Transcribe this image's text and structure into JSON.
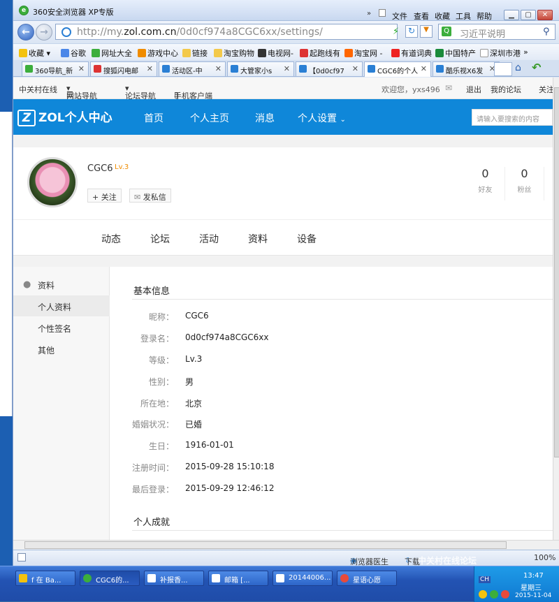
{
  "browser": {
    "title": "360安全浏览器 XP专版",
    "menu": [
      "文件",
      "查看",
      "收藏",
      "工具",
      "帮助"
    ],
    "address_prefix": "http://my.",
    "address_domain": "zol.com.cn",
    "address_suffix": "/0d0cf974a8CGC6xx/settings/",
    "search_text": "习近平说明",
    "favorites": [
      "收藏",
      "谷歌",
      "网址大全",
      "游戏中心",
      "链接",
      "淘宝购物",
      "电视网-",
      "起跑线有",
      "淘宝网 -",
      "有道词典",
      "中国特产",
      "深圳市港"
    ],
    "tabs": [
      {
        "label": "360导航_新",
        "color": "#3cae3c"
      },
      {
        "label": "搜狐闪电邮",
        "color": "#d33"
      },
      {
        "label": "活动区-中",
        "color": "#2a7fd4"
      },
      {
        "label": "大管家小s",
        "color": "#2a7fd4"
      },
      {
        "label": "【0d0cf97",
        "color": "#2a7fd4"
      },
      {
        "label": "CGC6的个人",
        "color": "#2a7fd4"
      },
      {
        "label": "酷乐视X6发",
        "color": "#2a7fd4"
      }
    ]
  },
  "site": {
    "topnav": {
      "home": "中关村在线",
      "site_nav": "网站导航",
      "forum_nav": "论坛导航",
      "mobile": "手机客户端",
      "welcome": "欢迎您，yxs496",
      "logout": "退出",
      "my_forum": "我的论坛",
      "follow": "关注"
    },
    "brand": "ZOL个人中心",
    "brand_z": "Z",
    "nav": [
      "首页",
      "个人主页",
      "消息",
      "个人设置"
    ],
    "search_placeholder": "请输入要搜索的内容"
  },
  "profile": {
    "name": "CGC6",
    "level": "Lv.3",
    "follow_btn": "关注",
    "message_btn": "发私信",
    "friends_count": "0",
    "friends_label": "好友",
    "fans_count": "0",
    "fans_label": "粉丝"
  },
  "content_tabs": [
    "动态",
    "论坛",
    "活动",
    "资料",
    "设备"
  ],
  "sidebar": {
    "header": "资料",
    "items": [
      "个人资料",
      "个性签名",
      "其他"
    ]
  },
  "basic_info": {
    "title": "基本信息",
    "rows": [
      {
        "label": "昵称：",
        "value": "CGC6"
      },
      {
        "label": "登录名：",
        "value": "0d0cf974a8CGC6xx"
      },
      {
        "label": "等级：",
        "value": "Lv.3"
      },
      {
        "label": "性别：",
        "value": "男"
      },
      {
        "label": "所在地：",
        "value": "北京"
      },
      {
        "label": "婚姻状况：",
        "value": "已婚"
      },
      {
        "label": "生日：",
        "value": "1916-01-01"
      },
      {
        "label": "注册时间：",
        "value": "2015-09-28 15:10:18"
      },
      {
        "label": "最后登录：",
        "value": "2015-09-29 12:46:12"
      }
    ],
    "achievements_title": "个人成就"
  },
  "statusbar": {
    "doctor": "浏览器医生",
    "download": "下载",
    "zoom": "100%"
  },
  "taskbar": {
    "items": [
      "f 在 Ba...",
      "CGC6的...",
      "补报香...",
      "邮箱 [...",
      "20144006...",
      "星语心愿"
    ],
    "time": "13:47",
    "weekday": "星期三",
    "date": "2015-11-04",
    "ime": "CH"
  },
  "watermark": "中关村在线论坛\nbbs.zol.com.cn"
}
